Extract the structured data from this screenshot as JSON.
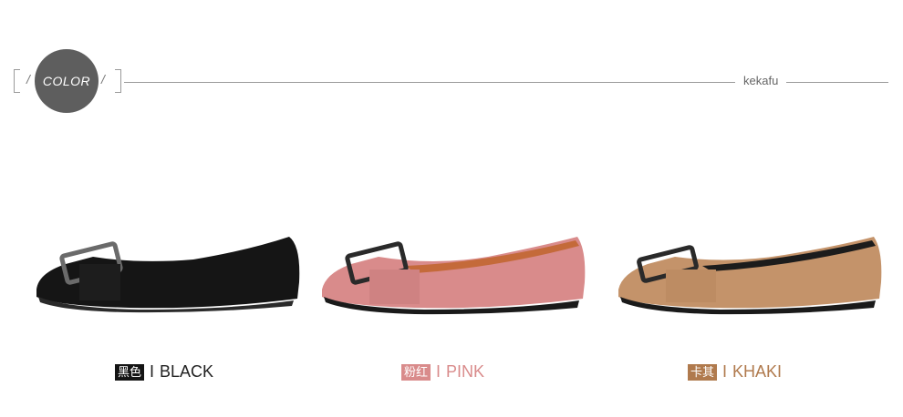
{
  "header": {
    "badge_text": "COLOR",
    "slash": "/",
    "brand": "kekafu"
  },
  "colors": {
    "accent_gray": "#5e5e5e",
    "black": "#141414",
    "pink": "#d98b8b",
    "khaki": "#b07a4d"
  },
  "products": [
    {
      "name_cn": "黑色",
      "sep": "I",
      "name_en": "BLACK",
      "tag_color": "#141414",
      "text_color": "#222222"
    },
    {
      "name_cn": "粉红",
      "sep": "I",
      "name_en": "PINK",
      "tag_color": "#d98b8b",
      "text_color": "#d98b8b"
    },
    {
      "name_cn": "卡其",
      "sep": "I",
      "name_en": "KHAKI",
      "tag_color": "#b07a4d",
      "text_color": "#b07a4d"
    }
  ]
}
